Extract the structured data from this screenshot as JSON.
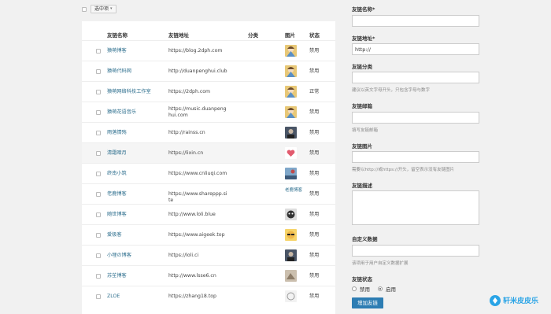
{
  "toolbar": {
    "bulk_select_label": "选中项"
  },
  "table": {
    "headers": {
      "name": "友链名称",
      "url": "友链地址",
      "category": "分类",
      "image": "图片",
      "status": "状态"
    },
    "rows": [
      {
        "name": "猿萌博客",
        "url": "https://blog.2dph.com",
        "status": "禁用",
        "img": "anime"
      },
      {
        "name": "猿萌代码网",
        "url": "http://duanpenghui.club",
        "status": "禁用",
        "img": "anime"
      },
      {
        "name": "猿萌网络科技工作室",
        "url": "https://2dph.com",
        "status": "正常",
        "img": "anime"
      },
      {
        "name": "猿萌花语音乐",
        "url": "https://music.duanpenghui.com",
        "status": "禁用",
        "img": "anime"
      },
      {
        "name": "雨落情殇",
        "url": "http://rainss.cn",
        "status": "禁用",
        "img": "photo"
      },
      {
        "name": "清霜暗月",
        "url": "https://lixin.cn",
        "status": "禁用",
        "img": "heart"
      },
      {
        "name": "终南小筑",
        "url": "https://www.cnliuqi.com",
        "status": "禁用",
        "img": "sky"
      },
      {
        "name": "老鹿博客",
        "url": "https://www.shareppp.site",
        "status": "禁用",
        "img": "broken",
        "img_alt": "老鹿博客"
      },
      {
        "name": "随世博客",
        "url": "http://www.loli.blue",
        "status": "禁用",
        "img": "face"
      },
      {
        "name": "爱极客",
        "url": "https://www.aigeek.top",
        "status": "禁用",
        "img": "glasses"
      },
      {
        "name": "小埋の博客",
        "url": "https://loli.ci",
        "status": "禁用",
        "img": "photo"
      },
      {
        "name": "苏苼博客",
        "url": "http://www.lsse6.cn",
        "status": "禁用",
        "img": "sketch"
      },
      {
        "name": "ZLOE",
        "url": "https://zhang18.top",
        "status": "禁用",
        "img": "gray"
      }
    ]
  },
  "form": {
    "name_label": "友链名称*",
    "url_label": "友链地址*",
    "url_value": "http://",
    "category_label": "友链分类",
    "category_hint": "建议以英文字母开头，只包含字母与数字",
    "email_label": "友链邮箱",
    "email_hint": "填写友链邮箱",
    "image_label": "友链图片",
    "image_hint": "需要以http://或https://开头，留空表示没有友链图片",
    "desc_label": "友链描述",
    "custom_label": "自定义数据",
    "custom_hint": "该项用于用户自定义数据扩展",
    "status_label": "友链状态",
    "status_disabled": "禁用",
    "status_enabled": "启用",
    "submit_label": "增加友链"
  },
  "watermark": {
    "text": "轩米皮皮乐"
  }
}
